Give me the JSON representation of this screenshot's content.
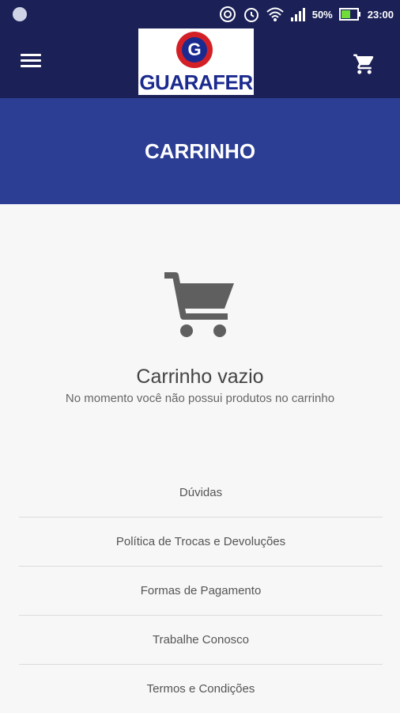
{
  "status_bar": {
    "battery": "50%",
    "time": "23:00"
  },
  "header": {
    "logo_text": "GUARAFER",
    "logo_letter": "G"
  },
  "banner": {
    "title": "CARRINHO"
  },
  "empty_state": {
    "title": "Carrinho vazio",
    "subtitle": "No momento você não possui produtos no carrinho"
  },
  "footer_links": [
    "Dúvidas",
    "Política de Trocas e Devoluções",
    "Formas de Pagamento",
    "Trabalhe Conosco",
    "Termos e Condições"
  ],
  "colors": {
    "header_bg": "#1b2157",
    "banner_bg": "#2c3e94",
    "logo_red": "#d32027",
    "logo_blue": "#1b2a8f"
  }
}
